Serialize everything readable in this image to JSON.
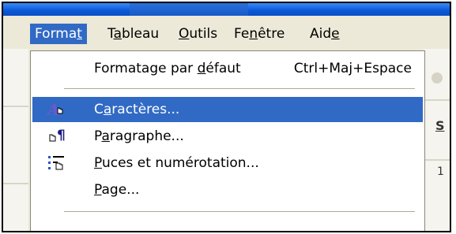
{
  "menubar": {
    "items": [
      {
        "pre": "Forma",
        "u": "t",
        "post": ""
      },
      {
        "pre": "T",
        "u": "a",
        "post": "bleau"
      },
      {
        "pre": "",
        "u": "O",
        "post": "utils"
      },
      {
        "pre": "Fe",
        "u": "n",
        "post": "être"
      },
      {
        "pre": "Aid",
        "u": "e",
        "post": ""
      }
    ]
  },
  "background": {
    "glyph_s": "S",
    "glyph_i": "1"
  },
  "dropdown": {
    "default_format": {
      "pre": "Formatage par ",
      "u": "d",
      "post": "éfaut",
      "shortcut": "Ctrl+Maj+Espace"
    },
    "characters": {
      "pre": "C",
      "u": "a",
      "post": "ractères..."
    },
    "paragraph": {
      "pre": "P",
      "u": "a",
      "post": "ragraphe..."
    },
    "bullets": {
      "pre": "",
      "u": "P",
      "post": "uces et numérotation..."
    },
    "page": {
      "pre": "",
      "u": "P",
      "post": "age..."
    },
    "icons": {
      "characters": "font-a-hand-icon",
      "paragraph": "pilcrow-hand-icon",
      "bullets": "bullet-list-hand-icon"
    }
  }
}
